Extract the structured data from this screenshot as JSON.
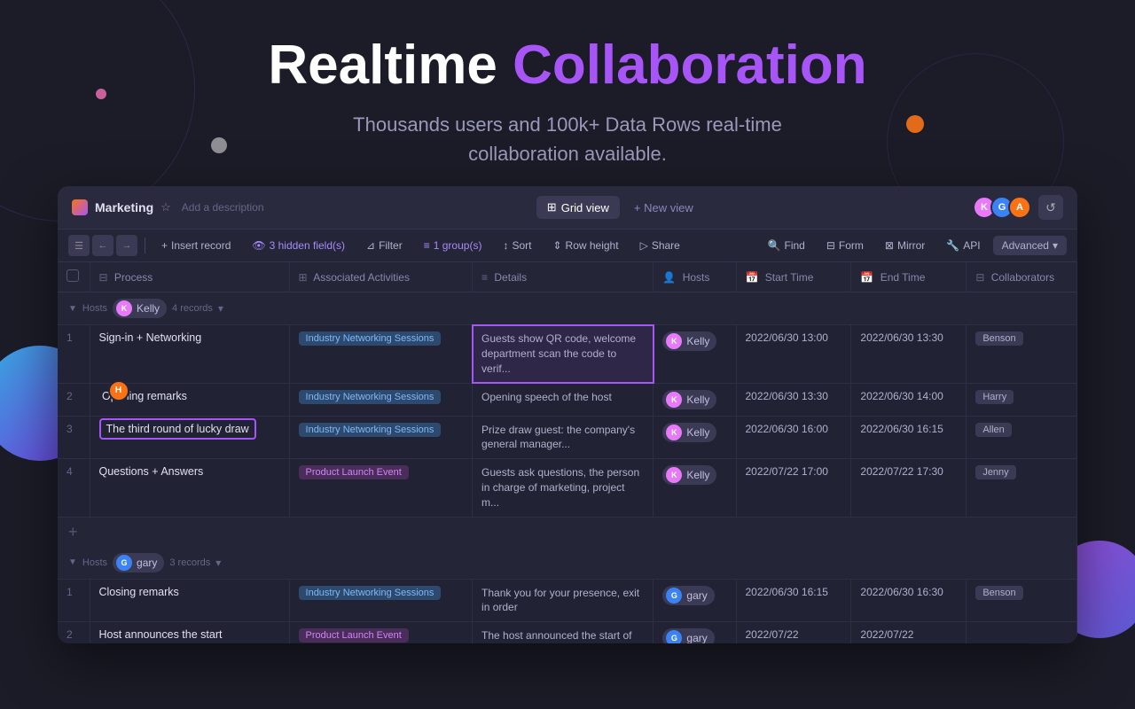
{
  "hero": {
    "title_plain": "Realtime",
    "title_highlight": "Collaboration",
    "subtitle_line1": "Thousands users and 100k+ Data Rows real-time",
    "subtitle_line2": "collaboration available."
  },
  "window": {
    "workspace_name": "Marketing",
    "add_description": "Add a description",
    "star_label": "☆",
    "tabs": [
      {
        "label": "Grid view",
        "icon": "⊞",
        "active": true
      },
      {
        "label": "+ New view",
        "active": false
      }
    ],
    "avatars": [
      {
        "initials": "K",
        "color": "#e879f9"
      },
      {
        "initials": "G",
        "color": "#3b82f6"
      },
      {
        "initials": "A",
        "color": "#f97316"
      }
    ],
    "refresh_icon": "↺"
  },
  "toolbar": {
    "nav_back": "←",
    "nav_forward": "→",
    "insert_record": "Insert record",
    "hidden_fields": "3 hidden field(s)",
    "filter": "Filter",
    "group": "1 group(s)",
    "sort": "Sort",
    "row_height": "Row height",
    "share": "Share",
    "find": "Find",
    "form": "Form",
    "mirror": "Mirror",
    "api": "API",
    "advanced": "Advanced"
  },
  "table": {
    "columns": [
      {
        "label": "",
        "icon": ""
      },
      {
        "label": "Process",
        "icon": "⊟"
      },
      {
        "label": "Associated Activities",
        "icon": "⊞"
      },
      {
        "label": "Details",
        "icon": "≡"
      },
      {
        "label": "Hosts",
        "icon": "👤"
      },
      {
        "label": "Start Time",
        "icon": "📅"
      },
      {
        "label": "End Time",
        "icon": "📅"
      },
      {
        "label": "Collaborators",
        "icon": "⊟"
      }
    ],
    "groups": [
      {
        "group_label": "Hosts",
        "group_value": "Kelly",
        "group_count": "4 records",
        "avatar_color": "#e879f9",
        "rows": [
          {
            "num": "1",
            "process": "Sign-in + Networking",
            "selected": false,
            "activity": "Industry Networking Sessions",
            "activity_type": "networking",
            "details": "Guests show QR code, welcome department scan the code to verif...",
            "host": "Kelly",
            "host_color": "#e879f9",
            "start": "2022/06/30 13:00",
            "end": "2022/06/30 13:30",
            "collaborator": "Benson",
            "details_selected": true
          },
          {
            "num": "2",
            "process": "Opening remarks",
            "selected": false,
            "activity": "Industry Networking Sessions",
            "activity_type": "networking",
            "details": "Opening speech of the host",
            "host": "Kelly",
            "host_color": "#e879f9",
            "start": "2022/06/30 13:30",
            "end": "2022/06/30 14:00",
            "collaborator": "Harry",
            "details_selected": false,
            "has_avatar": true,
            "avatar_color": "#f97316",
            "avatar_initial": "H"
          },
          {
            "num": "3",
            "process": "The third round of lucky draw",
            "selected": true,
            "activity": "Industry Networking Sessions",
            "activity_type": "networking",
            "details": "Prize draw guest: the company's general manager...",
            "host": "Kelly",
            "host_color": "#e879f9",
            "start": "2022/06/30 16:00",
            "end": "2022/06/30 16:15",
            "collaborator": "Allen",
            "details_selected": false
          },
          {
            "num": "4",
            "process": "Questions + Answers",
            "selected": false,
            "activity": "Product Launch Event",
            "activity_type": "product",
            "details": "Guests ask questions, the person in charge of marketing, project m...",
            "host": "Kelly",
            "host_color": "#e879f9",
            "start": "2022/07/22 17:00",
            "end": "2022/07/22 17:30",
            "collaborator": "Jenny",
            "details_selected": false
          }
        ]
      },
      {
        "group_label": "Hosts",
        "group_value": "gary",
        "group_count": "3 records",
        "avatar_color": "#3b82f6",
        "rows": [
          {
            "num": "1",
            "process": "Closing remarks",
            "selected": false,
            "activity": "Industry Networking Sessions",
            "activity_type": "networking",
            "details": "Thank you for your presence, exit in order",
            "host": "gary",
            "host_color": "#3b82f6",
            "start": "2022/06/30 16:15",
            "end": "2022/06/30 16:30",
            "collaborator": "Benson",
            "details_selected": false
          },
          {
            "num": "2",
            "process": "Host announces the start",
            "selected": false,
            "activity": "Product Launch Event",
            "activity_type": "product",
            "details": "The host announced the start of th...",
            "host": "gary",
            "host_color": "#3b82f6",
            "start": "2022/07/22",
            "end": "2022/07/22",
            "collaborator": "",
            "details_selected": false
          }
        ]
      }
    ]
  }
}
